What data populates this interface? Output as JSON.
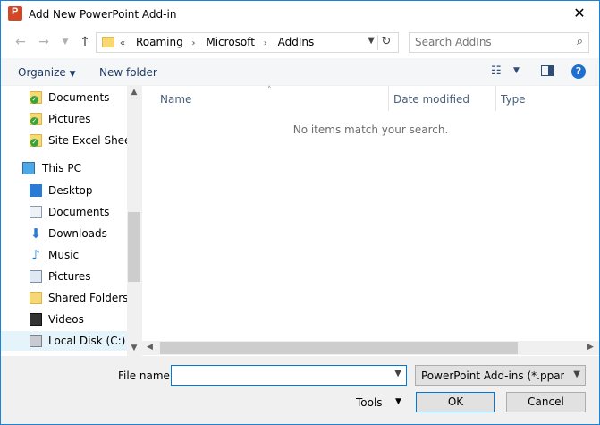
{
  "window": {
    "title": "Add New PowerPoint Add-in",
    "accent": "#1883d7"
  },
  "nav": {
    "back_icon": "back-arrow-icon",
    "forward_icon": "forward-arrow-icon",
    "recent_icon": "chevron-down-icon",
    "up_icon": "up-arrow-icon",
    "breadcrumb": {
      "overflow": "«",
      "items": [
        "Roaming",
        "Microsoft",
        "AddIns"
      ]
    },
    "search_placeholder": "Search AddIns"
  },
  "toolbar": {
    "organize": "Organize",
    "new_folder": "New folder"
  },
  "sidebar": {
    "items": [
      {
        "label": "Documents"
      },
      {
        "label": "Pictures"
      },
      {
        "label": "Site Excel Sheets"
      },
      {
        "label": "This PC"
      },
      {
        "label": "Desktop"
      },
      {
        "label": "Documents"
      },
      {
        "label": "Downloads"
      },
      {
        "label": "Music"
      },
      {
        "label": "Pictures"
      },
      {
        "label": "Shared Folders"
      },
      {
        "label": "Videos"
      },
      {
        "label": "Local Disk (C:)"
      }
    ]
  },
  "columns": {
    "name": "Name",
    "date": "Date modified",
    "type": "Type"
  },
  "empty_message": "No items match your search.",
  "footer": {
    "file_name_label": "File name:",
    "file_name_value": "",
    "file_type": "PowerPoint Add-ins (*.ppam;*.",
    "tools": "Tools",
    "ok": "OK",
    "cancel": "Cancel"
  }
}
